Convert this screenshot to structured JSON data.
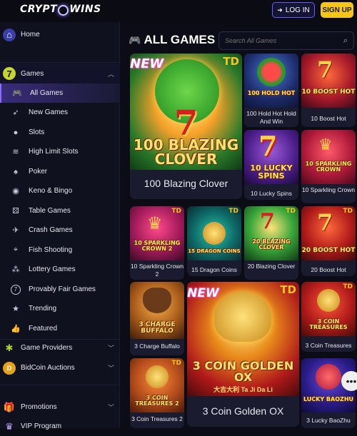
{
  "header": {
    "logo": "CRYPTOWINS",
    "logo_left": "CRYPT",
    "logo_right": "WINS",
    "login_label": "LOG IN",
    "signup_label": "SIGN UP"
  },
  "sidebar": {
    "home": "Home",
    "games": "Games",
    "items": [
      {
        "label": "All Games",
        "icon": "controller-icon"
      },
      {
        "label": "New Games",
        "icon": "rocket-icon"
      },
      {
        "label": "Slots",
        "icon": "cherries-icon"
      },
      {
        "label": "High Limit Slots",
        "icon": "wifi-icon"
      },
      {
        "label": "Poker",
        "icon": "spade-icon"
      },
      {
        "label": "Keno & Bingo",
        "icon": "ball-icon"
      },
      {
        "label": "Table Games",
        "icon": "dice-icon"
      },
      {
        "label": "Crash Games",
        "icon": "rocket-icon"
      },
      {
        "label": "Fish Shooting",
        "icon": "crosshair-icon"
      },
      {
        "label": "Lottery Games",
        "icon": "balls-icon"
      },
      {
        "label": "Provably Fair Games",
        "icon": "seven-icon"
      },
      {
        "label": "Trending",
        "icon": "star-icon"
      },
      {
        "label": "Featured",
        "icon": "thumbs-up-icon"
      }
    ],
    "game_providers": "Game Providers",
    "bidcoin_auctions": "BidCoin Auctions",
    "promotions": "Promotions",
    "vip_program": "VIP Program"
  },
  "main": {
    "title": "ALL GAMES",
    "search_placeholder": "Search All Games"
  },
  "games": [
    {
      "name": "100 Blazing Clover",
      "art": "100 BLAZING CLOVER",
      "badge": "NEW",
      "td": "TD"
    },
    {
      "name": "100 Hold Hot Hold And Win",
      "art": "100 HOLD HOT"
    },
    {
      "name": "10 Boost Hot",
      "art": "10 BOOST HOT"
    },
    {
      "name": "10 Lucky Spins",
      "art": "10 LUCKY SPINS"
    },
    {
      "name": "10 Sparkling Crown",
      "art": "10 SPARKLING CROWN"
    },
    {
      "name": "10 Sparkling Crown 2",
      "art": "10 SPARKLING CROWN 2",
      "td": "TD"
    },
    {
      "name": "15 Dragon Coins",
      "art": "15 DRAGON COINS",
      "td": "TD"
    },
    {
      "name": "20 Blazing Clover",
      "art": "20 BLAZING CLOVER",
      "td": "TD"
    },
    {
      "name": "20 Boost Hot",
      "art": "20 BOOST HOT",
      "td": "TD"
    },
    {
      "name": "3 Charge Buffalo",
      "art": "3 CHARGE BUFFALO"
    },
    {
      "name": "3 Coin Golden OX",
      "art": "3 COIN GOLDEN OX",
      "badge": "NEW",
      "td": "TD",
      "tagline": "大吉大利 Ta Ji Da Li"
    },
    {
      "name": "3 Coin Treasures",
      "art": "3 COIN TREASURES",
      "td": "TD"
    },
    {
      "name": "3 Coin Treasures 2",
      "art": "3 COIN TREASURES 2",
      "td": "TD"
    },
    {
      "name": "3 Lucky BaoZhu",
      "art": "LUCKY BAOZHU"
    }
  ],
  "chat_icon": "chat-icon"
}
